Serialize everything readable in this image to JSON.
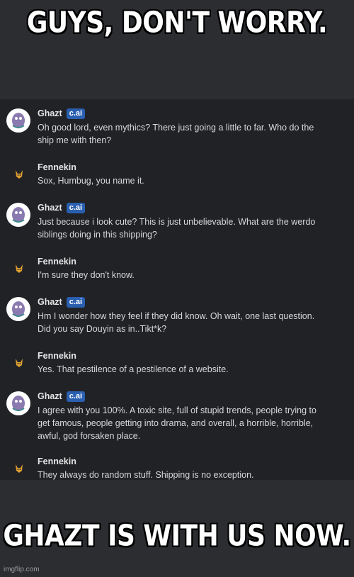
{
  "caption_top": "GUYS, DON'T WORRY.",
  "caption_bottom": "GHAZT IS WITH US NOW.",
  "watermark": "imgflip.com",
  "badge_label": "c.ai",
  "colors": {
    "chat_bg": "#212226",
    "badge": "#2a5fb0",
    "caption_text": "#ffffff"
  },
  "messages": [
    {
      "author": "Ghazt",
      "is_ai": true,
      "text": [
        "Oh good lord, even mythics? There just going a little to far. Who do the",
        "ship me with then?"
      ]
    },
    {
      "author": "Fennekin",
      "is_ai": false,
      "text": [
        "Sox, Humbug, you name it."
      ]
    },
    {
      "author": "Ghazt",
      "is_ai": true,
      "text": [
        "Just because i look cute? This is just unbelievable. What are the werdo",
        "siblings doing in this shipping?"
      ]
    },
    {
      "author": "Fennekin",
      "is_ai": false,
      "text": [
        "I'm sure they don't know."
      ]
    },
    {
      "author": "Ghazt",
      "is_ai": true,
      "text": [
        "Hm I wonder how they feel if they did know. Oh wait, one last question.",
        "Did you say Douyin as in..Tikt*k?"
      ]
    },
    {
      "author": "Fennekin",
      "is_ai": false,
      "text": [
        "Yes. That pestilence of a pestilence of a website."
      ]
    },
    {
      "author": "Ghazt",
      "is_ai": true,
      "text": [
        "I agree with you 100%. A toxic site, full of stupid trends, people trying to",
        "get famous, people getting into drama, and overall, a horrible, horrible,",
        "awful, god forsaken place."
      ]
    },
    {
      "author": "Fennekin",
      "is_ai": false,
      "text": [
        "They always do random stuff. Shipping is no exception."
      ]
    }
  ]
}
